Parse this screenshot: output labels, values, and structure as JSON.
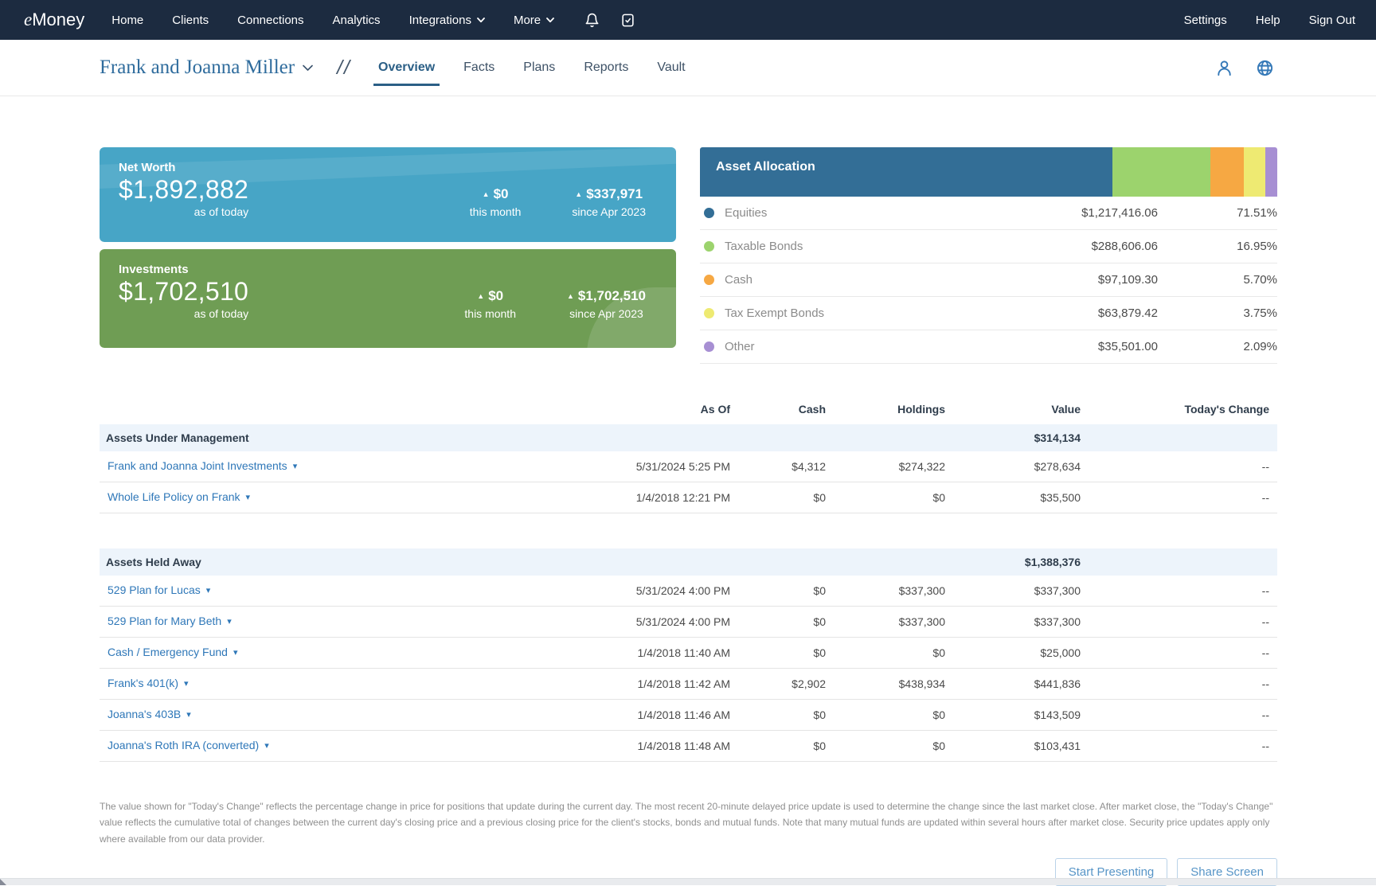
{
  "nav": {
    "brand": {
      "prefix": "e",
      "name": "Money"
    },
    "items": [
      {
        "label": "Home"
      },
      {
        "label": "Clients"
      },
      {
        "label": "Connections"
      },
      {
        "label": "Analytics"
      },
      {
        "label": "Integrations",
        "dropdown": true
      },
      {
        "label": "More",
        "dropdown": true
      }
    ],
    "right": [
      {
        "label": "Settings"
      },
      {
        "label": "Help"
      },
      {
        "label": "Sign Out"
      }
    ]
  },
  "header": {
    "client_name": "Frank and Joanna Miller",
    "tabs": [
      {
        "label": "Overview",
        "active": true
      },
      {
        "label": "Facts"
      },
      {
        "label": "Plans"
      },
      {
        "label": "Reports"
      },
      {
        "label": "Vault"
      }
    ]
  },
  "cards": {
    "net_worth": {
      "title": "Net Worth",
      "value": "$1,892,882",
      "as_of": "as of today",
      "color": "#47a5c6",
      "stats": [
        {
          "value": "$0",
          "label": "this month"
        },
        {
          "value": "$337,971",
          "label": "since Apr 2023"
        }
      ]
    },
    "investments": {
      "title": "Investments",
      "value": "$1,702,510",
      "as_of": "as of today",
      "color": "#6f9d54",
      "stats": [
        {
          "value": "$0",
          "label": "this month"
        },
        {
          "value": "$1,702,510",
          "label": "since Apr 2023"
        }
      ]
    }
  },
  "asset_allocation": {
    "title": "Asset Allocation",
    "rows": [
      {
        "label": "Equities",
        "value": "$1,217,416.06",
        "percent": "71.51%",
        "color": "#336e96"
      },
      {
        "label": "Taxable Bonds",
        "value": "$288,606.06",
        "percent": "16.95%",
        "color": "#9cd36d"
      },
      {
        "label": "Cash",
        "value": "$97,109.30",
        "percent": "5.70%",
        "color": "#f6a843"
      },
      {
        "label": "Tax Exempt Bonds",
        "value": "$63,879.42",
        "percent": "3.75%",
        "color": "#eeea72"
      },
      {
        "label": "Other",
        "value": "$35,501.00",
        "percent": "2.09%",
        "color": "#a78fd3"
      }
    ]
  },
  "table": {
    "columns": [
      "As Of",
      "Cash",
      "Holdings",
      "Value",
      "Today's Change"
    ],
    "sections": [
      {
        "title": "Assets Under Management",
        "total": "$314,134",
        "rows": [
          {
            "name": "Frank and Joanna Joint Investments",
            "as_of": "5/31/2024 5:25 PM",
            "cash": "$4,312",
            "holdings": "$274,322",
            "value": "$278,634",
            "change": "--"
          },
          {
            "name": "Whole Life Policy on Frank",
            "as_of": "1/4/2018 12:21 PM",
            "cash": "$0",
            "holdings": "$0",
            "value": "$35,500",
            "change": "--"
          }
        ]
      },
      {
        "title": "Assets Held Away",
        "total": "$1,388,376",
        "rows": [
          {
            "name": "529 Plan for Lucas",
            "as_of": "5/31/2024 4:00 PM",
            "cash": "$0",
            "holdings": "$337,300",
            "value": "$337,300",
            "change": "--"
          },
          {
            "name": "529 Plan for Mary Beth",
            "as_of": "5/31/2024 4:00 PM",
            "cash": "$0",
            "holdings": "$337,300",
            "value": "$337,300",
            "change": "--"
          },
          {
            "name": "Cash / Emergency Fund",
            "as_of": "1/4/2018 11:40 AM",
            "cash": "$0",
            "holdings": "$0",
            "value": "$25,000",
            "change": "--"
          },
          {
            "name": "Frank's 401(k)",
            "as_of": "1/4/2018 11:42 AM",
            "cash": "$2,902",
            "holdings": "$438,934",
            "value": "$441,836",
            "change": "--"
          },
          {
            "name": "Joanna's 403B",
            "as_of": "1/4/2018 11:46 AM",
            "cash": "$0",
            "holdings": "$0",
            "value": "$143,509",
            "change": "--"
          },
          {
            "name": "Joanna's Roth IRA (converted)",
            "as_of": "1/4/2018 11:48 AM",
            "cash": "$0",
            "holdings": "$0",
            "value": "$103,431",
            "change": "--"
          }
        ]
      }
    ]
  },
  "footer": {
    "disclaimer": "The value shown for \"Today's Change\" reflects the percentage change in price for positions that update during the current day. The most recent 20-minute delayed price update is used to determine the change since the last market close. After market close, the \"Today's Change\" value reflects the cumulative total of changes between the current day's closing price and a previous closing price for the client's stocks, bonds and mutual funds. Note that many mutual funds are updated within several hours after market close. Security price updates apply only where available from our data provider.",
    "buttons": [
      {
        "label": "Start Presenting"
      },
      {
        "label": "Share Screen"
      }
    ]
  }
}
